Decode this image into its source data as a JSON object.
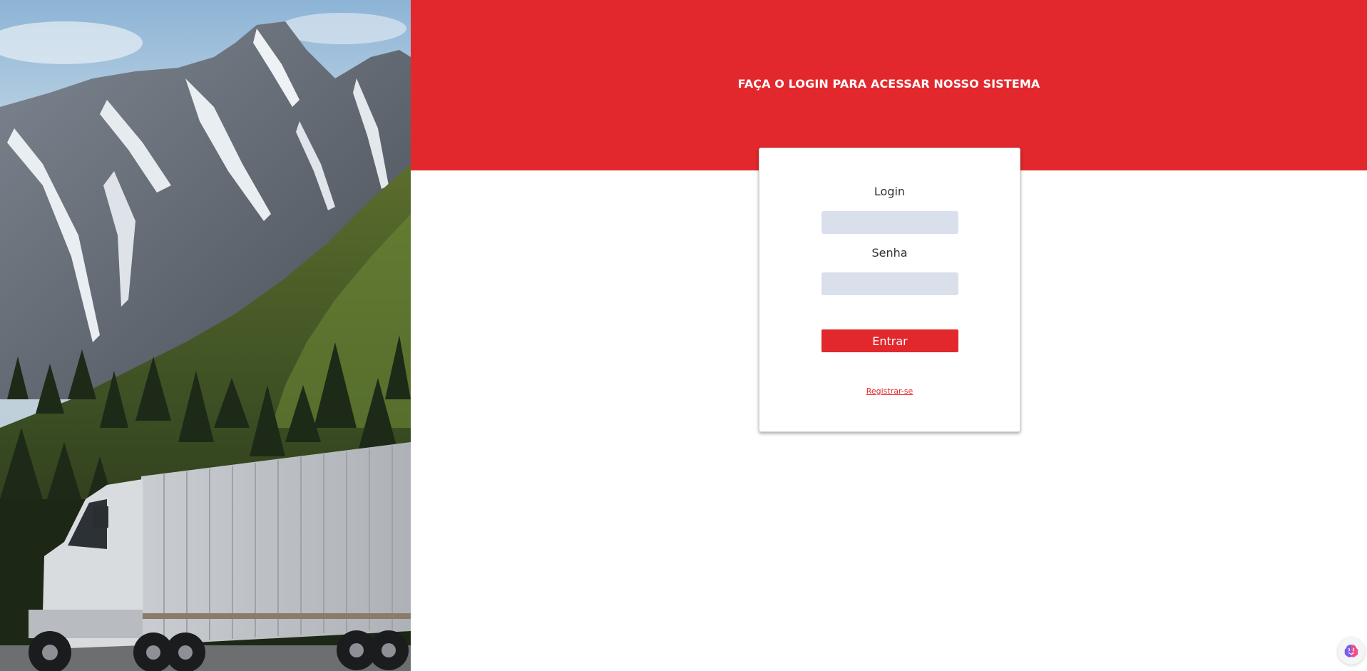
{
  "header": {
    "headline": "FAÇA O LOGIN PARA ACESSAR NOSSO SISTEMA"
  },
  "login_form": {
    "login_label": "Login",
    "login_value": "",
    "password_label": "Senha",
    "password_value": "",
    "submit_label": "Entrar",
    "register_link": "Registrar-se"
  },
  "hero": {
    "icon": "mountain-truck-photo"
  },
  "badge": {
    "icon": "brain-extension-icon"
  },
  "colors": {
    "accent": "#e2282d",
    "input_bg": "#dadfec",
    "text": "#2f3133"
  }
}
